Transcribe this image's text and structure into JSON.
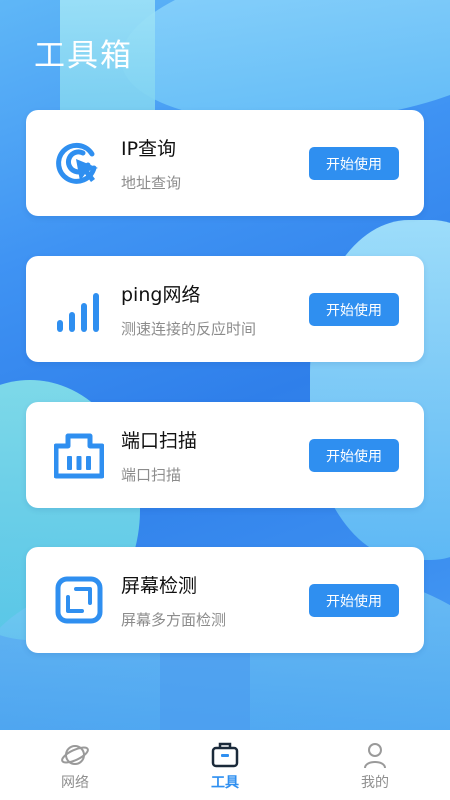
{
  "page": {
    "title": "工具箱"
  },
  "tools": [
    {
      "title": "IP查询",
      "desc": "地址查询",
      "button": "开始使用",
      "icon": "target-cursor-icon"
    },
    {
      "title": "ping网络",
      "desc": "测速连接的反应时间",
      "button": "开始使用",
      "icon": "signal-bars-icon"
    },
    {
      "title": "端口扫描",
      "desc": "端口扫描",
      "button": "开始使用",
      "icon": "port-icon"
    },
    {
      "title": "屏幕检测",
      "desc": "屏幕多方面检测",
      "button": "开始使用",
      "icon": "screen-frame-icon"
    }
  ],
  "tabbar": {
    "items": [
      {
        "label": "网络",
        "icon": "planet-icon",
        "active": false
      },
      {
        "label": "工具",
        "icon": "toolbox-icon",
        "active": true
      },
      {
        "label": "我的",
        "icon": "person-icon",
        "active": false
      }
    ]
  },
  "colors": {
    "accent": "#2f8ff0",
    "inactive": "#8f8f8f",
    "icon": "#2f8ff0"
  }
}
